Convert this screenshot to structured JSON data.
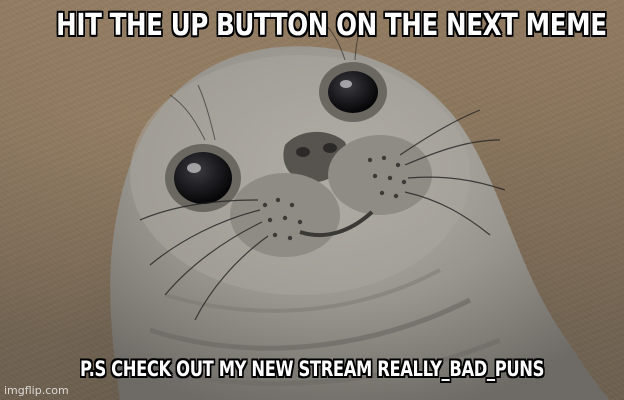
{
  "meme": {
    "top_text": "HIT THE UP BUTTON ON THE NEXT MEME",
    "bottom_text": "P.S CHECK OUT MY NEW STREAM REALLY_BAD_PUNS",
    "watermark": "imgflip.com",
    "image_subject": "awkward-seal"
  },
  "colors": {
    "caption_fill": "#ffffff",
    "caption_outline": "#000000",
    "background": "#7c6b57",
    "seal_fur": "#9a9790"
  }
}
